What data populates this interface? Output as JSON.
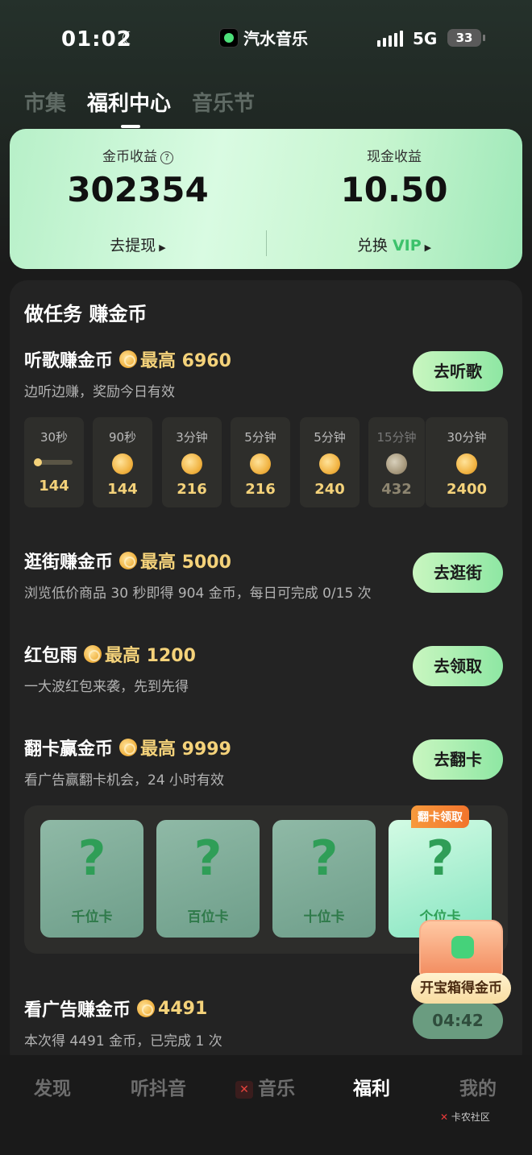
{
  "status_bar": {
    "time": "01:02",
    "app_name": "汽水音乐",
    "network": "5G",
    "battery": "33"
  },
  "tabs": [
    {
      "label": "市集",
      "active": false
    },
    {
      "label": "福利中心",
      "active": true
    },
    {
      "label": "音乐节",
      "active": false
    }
  ],
  "earnings": {
    "coin_label": "金币收益",
    "coin_value": "302354",
    "cash_label": "现金收益",
    "cash_value": "10.50",
    "withdraw_link": "去提现",
    "exchange_prefix": "兑换",
    "exchange_vip": "VIP"
  },
  "panel": {
    "title": "做任务 赚金币",
    "listen": {
      "title": "听歌赚金币",
      "max": "最高 6960",
      "sub": "边听边赚，奖励今日有效",
      "button": "去听歌",
      "chips": [
        {
          "duration": "30秒",
          "amount": "144",
          "state": "progress"
        },
        {
          "duration": "90秒",
          "amount": "144",
          "state": "normal"
        },
        {
          "duration": "3分钟",
          "amount": "216",
          "state": "normal"
        },
        {
          "duration": "5分钟",
          "amount": "216",
          "state": "normal"
        },
        {
          "duration": "5分钟",
          "amount": "240",
          "state": "normal"
        },
        {
          "duration": "15分钟",
          "amount": "432",
          "state": "dim"
        },
        {
          "duration": "30分钟",
          "amount": "2400",
          "state": "normal"
        }
      ]
    },
    "shop": {
      "title": "逛街赚金币",
      "max": "最高 5000",
      "sub": "浏览低价商品 30 秒即得 904 金币，每日可完成 0/15 次",
      "button": "去逛街"
    },
    "redpack": {
      "title": "红包雨",
      "max": "最高 1200",
      "sub": "一大波红包来袭，先到先得",
      "button": "去领取"
    },
    "flip": {
      "title": "翻卡赢金币",
      "max": "最高 9999",
      "sub": "看广告赢翻卡机会，24 小时有效",
      "button": "去翻卡",
      "badge": "翻卡领取",
      "cards": [
        {
          "symbol": "?",
          "label": "千位卡"
        },
        {
          "symbol": "?",
          "label": "百位卡"
        },
        {
          "symbol": "?",
          "label": "十位卡"
        },
        {
          "symbol": "?",
          "label": "个位卡"
        }
      ]
    },
    "ad": {
      "title": "看广告赚金币",
      "max": "4491",
      "sub": "本次得 4491 金币，已完成 1 次",
      "button": "04:42"
    },
    "treasure": {
      "label": "开宝箱得金币"
    }
  },
  "bottom_nav": [
    {
      "label": "发现",
      "active": false
    },
    {
      "label": "听抖音",
      "active": false
    },
    {
      "label": "音乐",
      "active": false
    },
    {
      "label": "福利",
      "active": true
    },
    {
      "label": "我的",
      "active": false
    }
  ],
  "watermark": "卡农社区",
  "colors": {
    "accent_green": "#8ee7a3",
    "coin_gold": "#f4d27a",
    "background": "#1b1b1b"
  }
}
